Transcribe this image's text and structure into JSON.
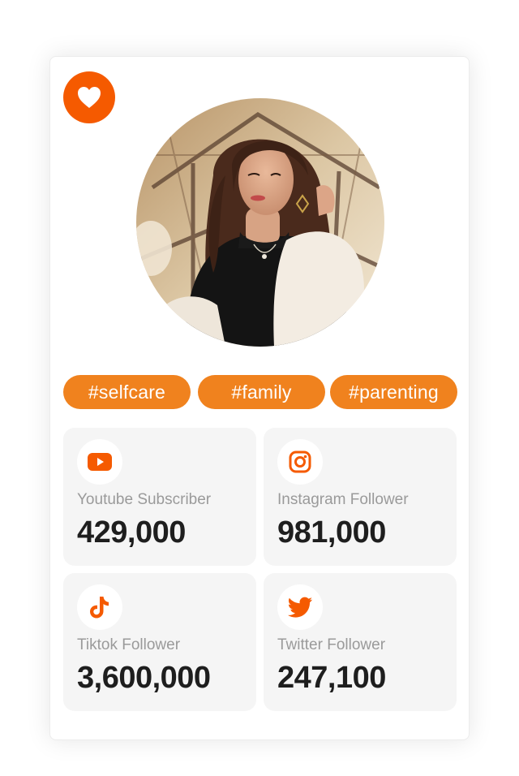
{
  "profile": {
    "favorite_icon": "heart-icon",
    "avatar": "profile-photo"
  },
  "tags": [
    {
      "label": "#selfcare"
    },
    {
      "label": "#family"
    },
    {
      "label": "#parenting"
    }
  ],
  "stats": [
    {
      "icon": "youtube-icon",
      "label": "Youtube Subscriber",
      "value": "429,000"
    },
    {
      "icon": "instagram-icon",
      "label": "Instagram Follower",
      "value": "981,000"
    },
    {
      "icon": "tiktok-icon",
      "label": "Tiktok Follower",
      "value": "3,600,000"
    },
    {
      "icon": "twitter-icon",
      "label": "Twitter Follower",
      "value": "247,100"
    }
  ],
  "colors": {
    "accent": "#f55a00",
    "tag": "#f0821e",
    "card_bg": "#f5f5f5"
  }
}
